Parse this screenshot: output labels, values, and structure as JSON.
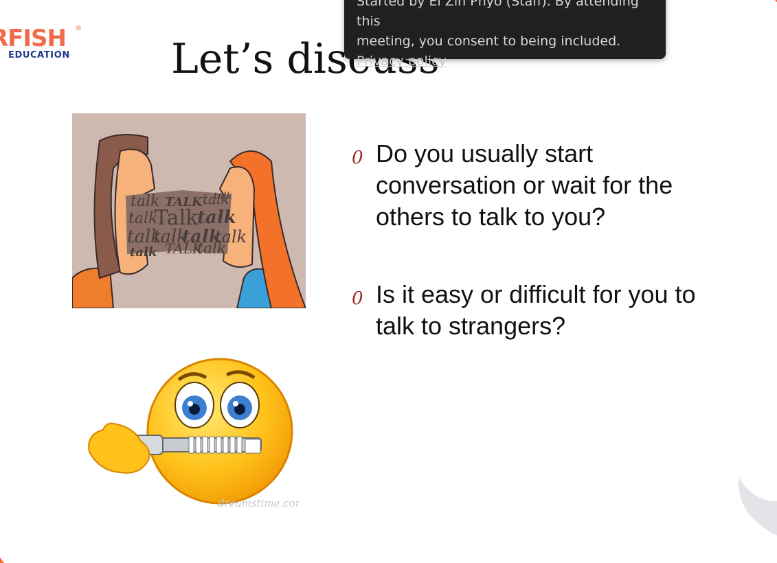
{
  "logo": {
    "text": "RFISH",
    "registered": "®",
    "subtitle": "EDUCATION"
  },
  "slide": {
    "title": "Let’s discuss",
    "bullets": [
      {
        "marker": "0",
        "text": "Do you usually start conversation or wait for the others to talk to you?"
      },
      {
        "marker": "0",
        "text": "Is it easy or difficult for you to talk to strangers?"
      }
    ]
  },
  "talk_image": {
    "words": [
      "talk",
      "TALK",
      "talk",
      "talk",
      "Talk",
      "talk",
      "talk",
      "talk",
      "talk",
      "talk",
      "talk",
      "TALK",
      "talk",
      "talk"
    ]
  },
  "emoji_image": {
    "watermark": "dreamstime.com"
  },
  "toast": {
    "line1": "Started by Ei Zin Phyo (Staff). By attending this",
    "line2": "meeting, you consent to being included.",
    "link": "Privacy policy"
  },
  "colors": {
    "logo_orange": "#f16b4b",
    "logo_blue": "#1f3b8c",
    "bullet_marker": "#9a2a2a",
    "toast_bg": "#202020",
    "accent_orange": "#ff6a3d"
  }
}
